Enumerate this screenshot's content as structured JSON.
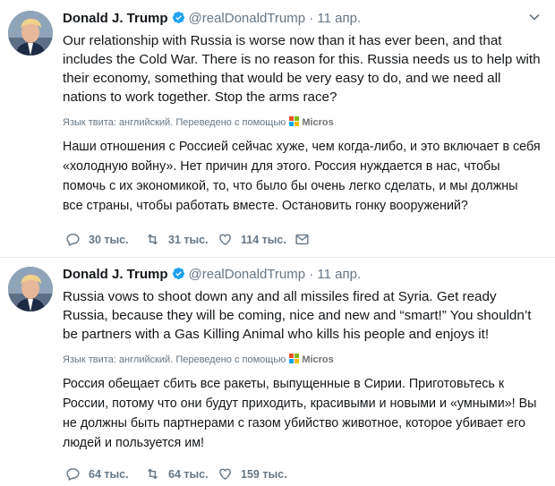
{
  "colors": {
    "verified": "#1da1f2",
    "text": "#14171a",
    "muted": "#657786",
    "divider": "#e6ecf0"
  },
  "tweets": [
    {
      "author": {
        "name": "Donald J. Trump",
        "handle": "@realDonaldTrump",
        "verified_icon": "verified-badge-icon"
      },
      "separator": "·",
      "date": "11 апр.",
      "text": "Our relationship with Russia is worse now than it has ever been, and that includes the Cold War. There is no reason for this. Russia needs us to help with their economy, something that would be very easy to do, and we need all nations to work together. Stop the arms race?",
      "translation_label": "Язык твита: английский. Переведено с помощью",
      "translation_provider": "Micros",
      "translated_text": "Наши отношения с Россией сейчас хуже, чем когда-либо, и это включает в себя «холодную войну». Нет причин для этого. Россия нуждается в нас, чтобы помочь с их экономикой, то, что было бы очень легко сделать, и мы должны все страны, чтобы работать вместе. Остановить гонку вооружений?",
      "actions": {
        "replies": "30 тыс.",
        "retweets": "31 тыс.",
        "likes": "114 тыс."
      }
    },
    {
      "author": {
        "name": "Donald J. Trump",
        "handle": "@realDonaldTrump",
        "verified_icon": "verified-badge-icon"
      },
      "separator": "·",
      "date": "11 апр.",
      "text": "Russia vows to shoot down any and all missiles fired at Syria. Get ready Russia, because they will be coming, nice and new and “smart!” You shouldn’t be partners with a Gas Killing Animal who kills his people and enjoys it!",
      "translation_label": "Язык твита: английский. Переведено с помощью",
      "translation_provider": "Micros",
      "translated_text": "Россия обещает сбить все ракеты, выпущенные в Сирии. Приготовьтесь к России, потому что они будут приходить, красивыми и новыми и «умными»! Вы не должны быть партнерами с газом убийство животное, которое убивает его людей и пользуется им!",
      "actions": {
        "replies": "64 тыс.",
        "retweets": "64 тыс.",
        "likes": "159 тыс."
      }
    }
  ]
}
